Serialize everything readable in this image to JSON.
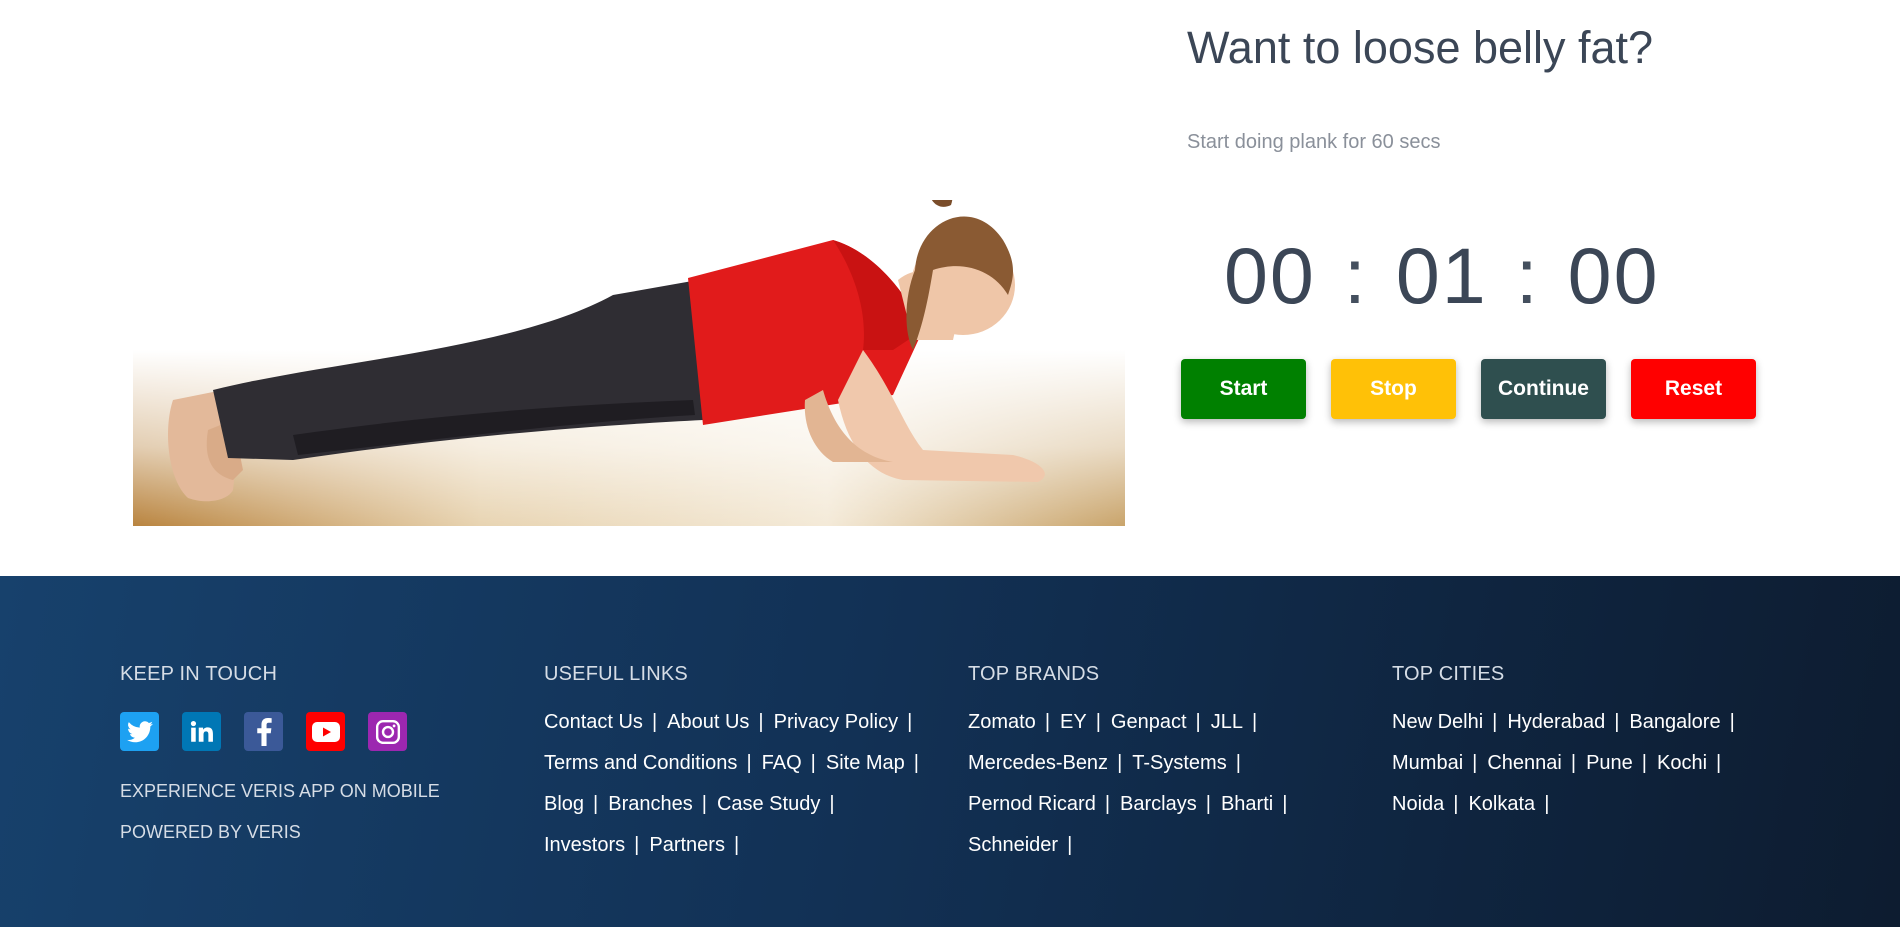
{
  "hero": {
    "headline": "Want to loose belly fat?",
    "subline": "Start doing plank for 60 secs",
    "timer": {
      "hours": "00",
      "minutes": "01",
      "seconds": "00",
      "separator": ":"
    },
    "buttons": {
      "start": {
        "label": "Start",
        "color": "#008000"
      },
      "stop": {
        "label": "Stop",
        "color": "#ffc107"
      },
      "continue": {
        "label": "Continue",
        "color": "#2f4f4f"
      },
      "reset": {
        "label": "Reset",
        "color": "#ff0000"
      }
    }
  },
  "footer": {
    "keep_in_touch": {
      "title": "KEEP IN TOUCH",
      "socials": [
        {
          "icon": "twitter-icon",
          "color": "#1da1f2"
        },
        {
          "icon": "linkedin-icon",
          "color": "#0077b5"
        },
        {
          "icon": "facebook-icon",
          "color": "#3b5998"
        },
        {
          "icon": "youtube-icon",
          "color": "#ff0000"
        },
        {
          "icon": "instagram-icon",
          "color": "#9c27b0"
        }
      ],
      "app_line": "EXPERIENCE VERIS APP ON MOBILE",
      "powered_line": "POWERED BY VERIS"
    },
    "useful_links": {
      "title": "USEFUL LINKS",
      "rows": [
        [
          "Contact Us",
          "About Us",
          "Privacy Policy"
        ],
        [
          "Terms and Conditions",
          "FAQ",
          "Site Map"
        ],
        [
          "Blog",
          "Branches",
          "Case Study"
        ],
        [
          "Investors",
          "Partners"
        ]
      ]
    },
    "top_brands": {
      "title": "TOP BRANDS",
      "rows": [
        [
          "Zomato",
          "EY",
          "Genpact",
          "JLL"
        ],
        [
          "Mercedes-Benz",
          "T-Systems"
        ],
        [
          "Pernod Ricard",
          "Barclays",
          "Bharti"
        ],
        [
          "Schneider"
        ]
      ]
    },
    "top_cities": {
      "title": "TOP CITIES",
      "rows": [
        [
          "New Delhi",
          "Hyderabad",
          "Bangalore"
        ],
        [
          "Mumbai",
          "Chennai",
          "Pune",
          "Kochi"
        ],
        [
          "Noida",
          "Kolkata"
        ]
      ]
    }
  }
}
